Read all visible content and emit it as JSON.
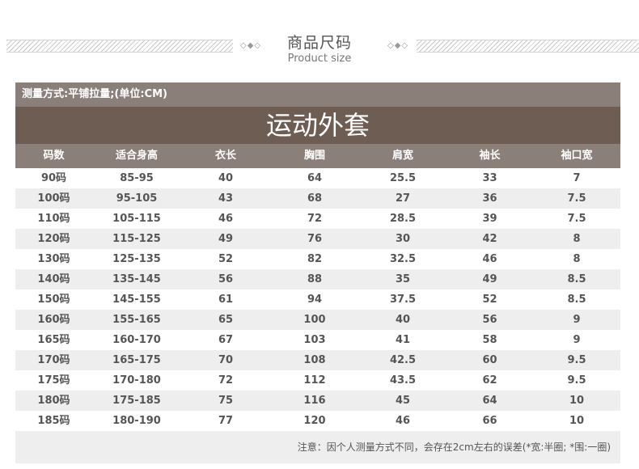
{
  "header": {
    "title_cn": "商品尺码",
    "title_en": "Product size",
    "diamonds": "◇◆◇"
  },
  "table": {
    "method_label": "测量方式:平铺拉量;(单位:CM)",
    "title": "运动外套",
    "columns": [
      "码数",
      "适合身高",
      "衣长",
      "胸围",
      "肩宽",
      "袖长",
      "袖口宽"
    ],
    "rows": [
      [
        "90码",
        "85-95",
        "40",
        "64",
        "25.5",
        "33",
        "7"
      ],
      [
        "100码",
        "95-105",
        "43",
        "68",
        "27",
        "36",
        "7.5"
      ],
      [
        "110码",
        "105-115",
        "46",
        "72",
        "28.5",
        "39",
        "7.5"
      ],
      [
        "120码",
        "115-125",
        "49",
        "76",
        "30",
        "42",
        "8"
      ],
      [
        "130码",
        "125-135",
        "52",
        "82",
        "32.5",
        "46",
        "8"
      ],
      [
        "140码",
        "135-145",
        "56",
        "88",
        "35",
        "49",
        "8.5"
      ],
      [
        "150码",
        "145-155",
        "61",
        "94",
        "37.5",
        "52",
        "8.5"
      ],
      [
        "160码",
        "155-165",
        "65",
        "100",
        "40",
        "56",
        "9"
      ],
      [
        "165码",
        "160-170",
        "67",
        "103",
        "41",
        "58",
        "9"
      ],
      [
        "170码",
        "165-175",
        "70",
        "108",
        "42.5",
        "60",
        "9.5"
      ],
      [
        "175码",
        "170-180",
        "72",
        "112",
        "43.5",
        "62",
        "9.5"
      ],
      [
        "180码",
        "175-185",
        "75",
        "116",
        "45",
        "64",
        "10"
      ],
      [
        "185码",
        "180-190",
        "77",
        "120",
        "46",
        "66",
        "10"
      ]
    ],
    "note": "注意：因个人测量方式不同，会存在2cm左右的误差(*宽:半圈; *围:一圈)"
  }
}
